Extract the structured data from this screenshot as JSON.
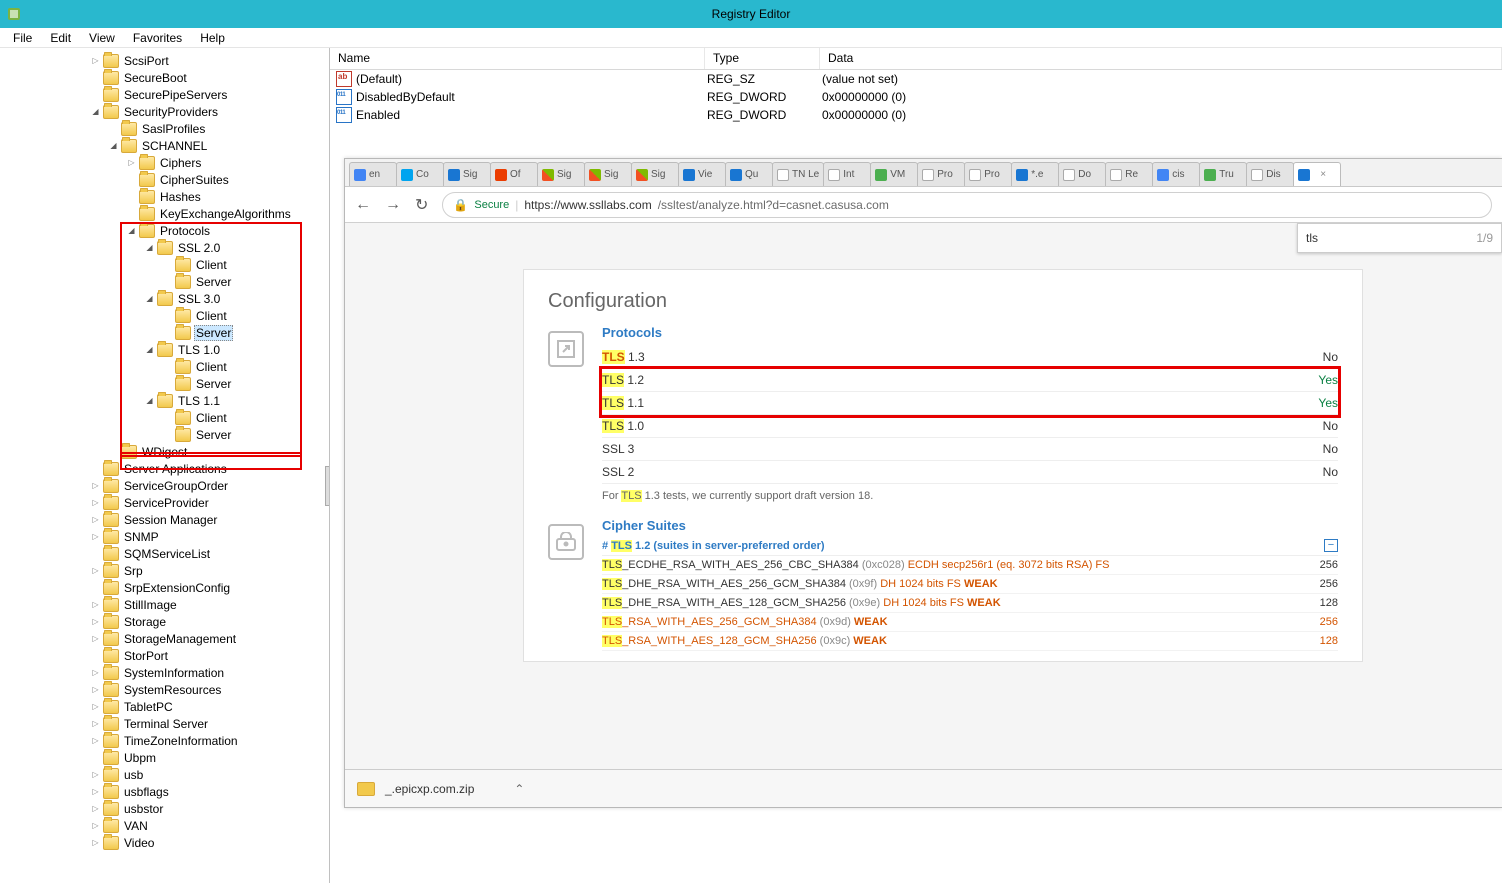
{
  "window": {
    "title": "Registry Editor"
  },
  "menu": {
    "file": "File",
    "edit": "Edit",
    "view": "View",
    "favorites": "Favorites",
    "help": "Help"
  },
  "tree": [
    {
      "ind": 90,
      "exp": "closed",
      "label": "ScsiPort"
    },
    {
      "ind": 90,
      "exp": "",
      "label": "SecureBoot"
    },
    {
      "ind": 90,
      "exp": "",
      "label": "SecurePipeServers"
    },
    {
      "ind": 90,
      "exp": "open",
      "label": "SecurityProviders"
    },
    {
      "ind": 108,
      "exp": "",
      "label": "SaslProfiles"
    },
    {
      "ind": 108,
      "exp": "open",
      "label": "SCHANNEL"
    },
    {
      "ind": 126,
      "exp": "closed",
      "label": "Ciphers"
    },
    {
      "ind": 126,
      "exp": "",
      "label": "CipherSuites"
    },
    {
      "ind": 126,
      "exp": "",
      "label": "Hashes"
    },
    {
      "ind": 126,
      "exp": "",
      "label": "KeyExchangeAlgorithms"
    },
    {
      "ind": 126,
      "exp": "open",
      "label": "Protocols"
    },
    {
      "ind": 144,
      "exp": "open",
      "label": "SSL 2.0"
    },
    {
      "ind": 162,
      "exp": "",
      "label": "Client"
    },
    {
      "ind": 162,
      "exp": "",
      "label": "Server"
    },
    {
      "ind": 144,
      "exp": "open",
      "label": "SSL 3.0"
    },
    {
      "ind": 162,
      "exp": "",
      "label": "Client"
    },
    {
      "ind": 162,
      "exp": "",
      "label": "Server",
      "selected": true
    },
    {
      "ind": 144,
      "exp": "open",
      "label": "TLS 1.0"
    },
    {
      "ind": 162,
      "exp": "",
      "label": "Client"
    },
    {
      "ind": 162,
      "exp": "",
      "label": "Server"
    },
    {
      "ind": 144,
      "exp": "open",
      "label": "TLS 1.1"
    },
    {
      "ind": 162,
      "exp": "",
      "label": "Client"
    },
    {
      "ind": 162,
      "exp": "",
      "label": "Server"
    },
    {
      "ind": 108,
      "exp": "",
      "label": "WDigest"
    },
    {
      "ind": 90,
      "exp": "",
      "label": "Server Applications"
    },
    {
      "ind": 90,
      "exp": "closed",
      "label": "ServiceGroupOrder"
    },
    {
      "ind": 90,
      "exp": "closed",
      "label": "ServiceProvider"
    },
    {
      "ind": 90,
      "exp": "closed",
      "label": "Session Manager"
    },
    {
      "ind": 90,
      "exp": "closed",
      "label": "SNMP"
    },
    {
      "ind": 90,
      "exp": "",
      "label": "SQMServiceList"
    },
    {
      "ind": 90,
      "exp": "closed",
      "label": "Srp"
    },
    {
      "ind": 90,
      "exp": "",
      "label": "SrpExtensionConfig"
    },
    {
      "ind": 90,
      "exp": "closed",
      "label": "StillImage"
    },
    {
      "ind": 90,
      "exp": "closed",
      "label": "Storage"
    },
    {
      "ind": 90,
      "exp": "closed",
      "label": "StorageManagement"
    },
    {
      "ind": 90,
      "exp": "",
      "label": "StorPort"
    },
    {
      "ind": 90,
      "exp": "closed",
      "label": "SystemInformation"
    },
    {
      "ind": 90,
      "exp": "closed",
      "label": "SystemResources"
    },
    {
      "ind": 90,
      "exp": "closed",
      "label": "TabletPC"
    },
    {
      "ind": 90,
      "exp": "closed",
      "label": "Terminal Server"
    },
    {
      "ind": 90,
      "exp": "closed",
      "label": "TimeZoneInformation"
    },
    {
      "ind": 90,
      "exp": "",
      "label": "Ubpm"
    },
    {
      "ind": 90,
      "exp": "closed",
      "label": "usb"
    },
    {
      "ind": 90,
      "exp": "closed",
      "label": "usbflags"
    },
    {
      "ind": 90,
      "exp": "closed",
      "label": "usbstor"
    },
    {
      "ind": 90,
      "exp": "closed",
      "label": "VAN"
    },
    {
      "ind": 90,
      "exp": "closed",
      "label": "Video"
    }
  ],
  "list": {
    "headers": {
      "name": "Name",
      "type": "Type",
      "data": "Data"
    },
    "rows": [
      {
        "ico": "ab",
        "name": "(Default)",
        "type": "REG_SZ",
        "data": "(value not set)"
      },
      {
        "ico": "dw",
        "name": "DisabledByDefault",
        "type": "REG_DWORD",
        "data": "0x00000000 (0)"
      },
      {
        "ico": "dw",
        "name": "Enabled",
        "type": "REG_DWORD",
        "data": "0x00000000 (0)"
      }
    ]
  },
  "browser": {
    "tabs": [
      {
        "cls": "g",
        "t": "en"
      },
      {
        "cls": "t",
        "t": "Co"
      },
      {
        "cls": "bl",
        "t": "Sig"
      },
      {
        "cls": "o",
        "t": "Of"
      },
      {
        "cls": "ms",
        "t": "Sig"
      },
      {
        "cls": "ms",
        "t": "Sig"
      },
      {
        "cls": "ms",
        "t": "Sig"
      },
      {
        "cls": "bl",
        "t": "Vie"
      },
      {
        "cls": "bl",
        "t": "Qu"
      },
      {
        "cls": "pg",
        "t": "TN Le"
      },
      {
        "cls": "pg",
        "t": "Int"
      },
      {
        "cls": "gr",
        "t": "VM"
      },
      {
        "cls": "pg",
        "t": "Pro"
      },
      {
        "cls": "pg",
        "t": "Pro"
      },
      {
        "cls": "bl",
        "t": "*.e"
      },
      {
        "cls": "pg",
        "t": "Do"
      },
      {
        "cls": "pg",
        "t": "Re"
      },
      {
        "cls": "g",
        "t": "cis"
      },
      {
        "cls": "gr",
        "t": "Tru"
      },
      {
        "cls": "pg",
        "t": "Dis"
      },
      {
        "cls": "bl active",
        "t": ""
      }
    ],
    "secure": "Secure",
    "url_host": "https://www.ssllabs.com",
    "url_path": "/ssltest/analyze.html?d=casnet.casusa.com",
    "find_text": "tls",
    "find_count": "1/9",
    "config_h": "Configuration",
    "protocols_h": "Protocols",
    "protocols": [
      {
        "hl": "o",
        "name": "TLS",
        "suffix": " 1.3",
        "val": "No",
        "cls": ""
      },
      {
        "hl": "y",
        "name": "TLS",
        "suffix": " 1.2",
        "val": "Yes",
        "cls": "yes",
        "box": "start"
      },
      {
        "hl": "y",
        "name": "TLS",
        "suffix": " 1.1",
        "val": "Yes",
        "cls": "yes",
        "box": "end"
      },
      {
        "hl": "y",
        "name": "TLS",
        "suffix": " 1.0",
        "val": "No",
        "cls": ""
      },
      {
        "hl": "",
        "name": "SSL 3",
        "suffix": "",
        "val": "No",
        "cls": ""
      },
      {
        "hl": "",
        "name": "SSL 2",
        "suffix": "",
        "val": "No",
        "cls": ""
      }
    ],
    "note_pre": "For ",
    "note_hl": "TLS",
    "note_post": " 1.3 tests, we currently support draft version 18.",
    "ciphers_h": "Cipher Suites",
    "ciphers_sub_pre": "# ",
    "ciphers_sub_hl": "TLS",
    "ciphers_sub_post": " 1.2 (suites in server-preferred order)",
    "ciphers": [
      {
        "o": false,
        "hl": "TLS",
        "n": "_ECDHE_RSA_WITH_AES_256_CBC_SHA384 ",
        "hx": "(0xc028)",
        "extra": "   ECDH secp256r1 (eq. 3072 bits RSA)   FS",
        "wk": "",
        "v": "256"
      },
      {
        "o": false,
        "hl": "TLS",
        "n": "_DHE_RSA_WITH_AES_256_GCM_SHA384 ",
        "hx": "(0x9f)",
        "extra": "   DH 1024 bits   FS   ",
        "wk": "WEAK",
        "v": "256"
      },
      {
        "o": false,
        "hl": "TLS",
        "n": "_DHE_RSA_WITH_AES_128_GCM_SHA256 ",
        "hx": "(0x9e)",
        "extra": "   DH 1024 bits   FS   ",
        "wk": "WEAK",
        "v": "128"
      },
      {
        "o": true,
        "hl": "TLS",
        "n": "_RSA_WITH_AES_256_GCM_SHA384 ",
        "hx": "(0x9d)",
        "extra": "   ",
        "wk": "WEAK",
        "v": "256"
      },
      {
        "o": true,
        "hl": "TLS",
        "n": "_RSA_WITH_AES_128_GCM_SHA256 ",
        "hx": "(0x9c)",
        "extra": "   ",
        "wk": "WEAK",
        "v": "128"
      }
    ],
    "download": "_.epicxp.com.zip"
  }
}
